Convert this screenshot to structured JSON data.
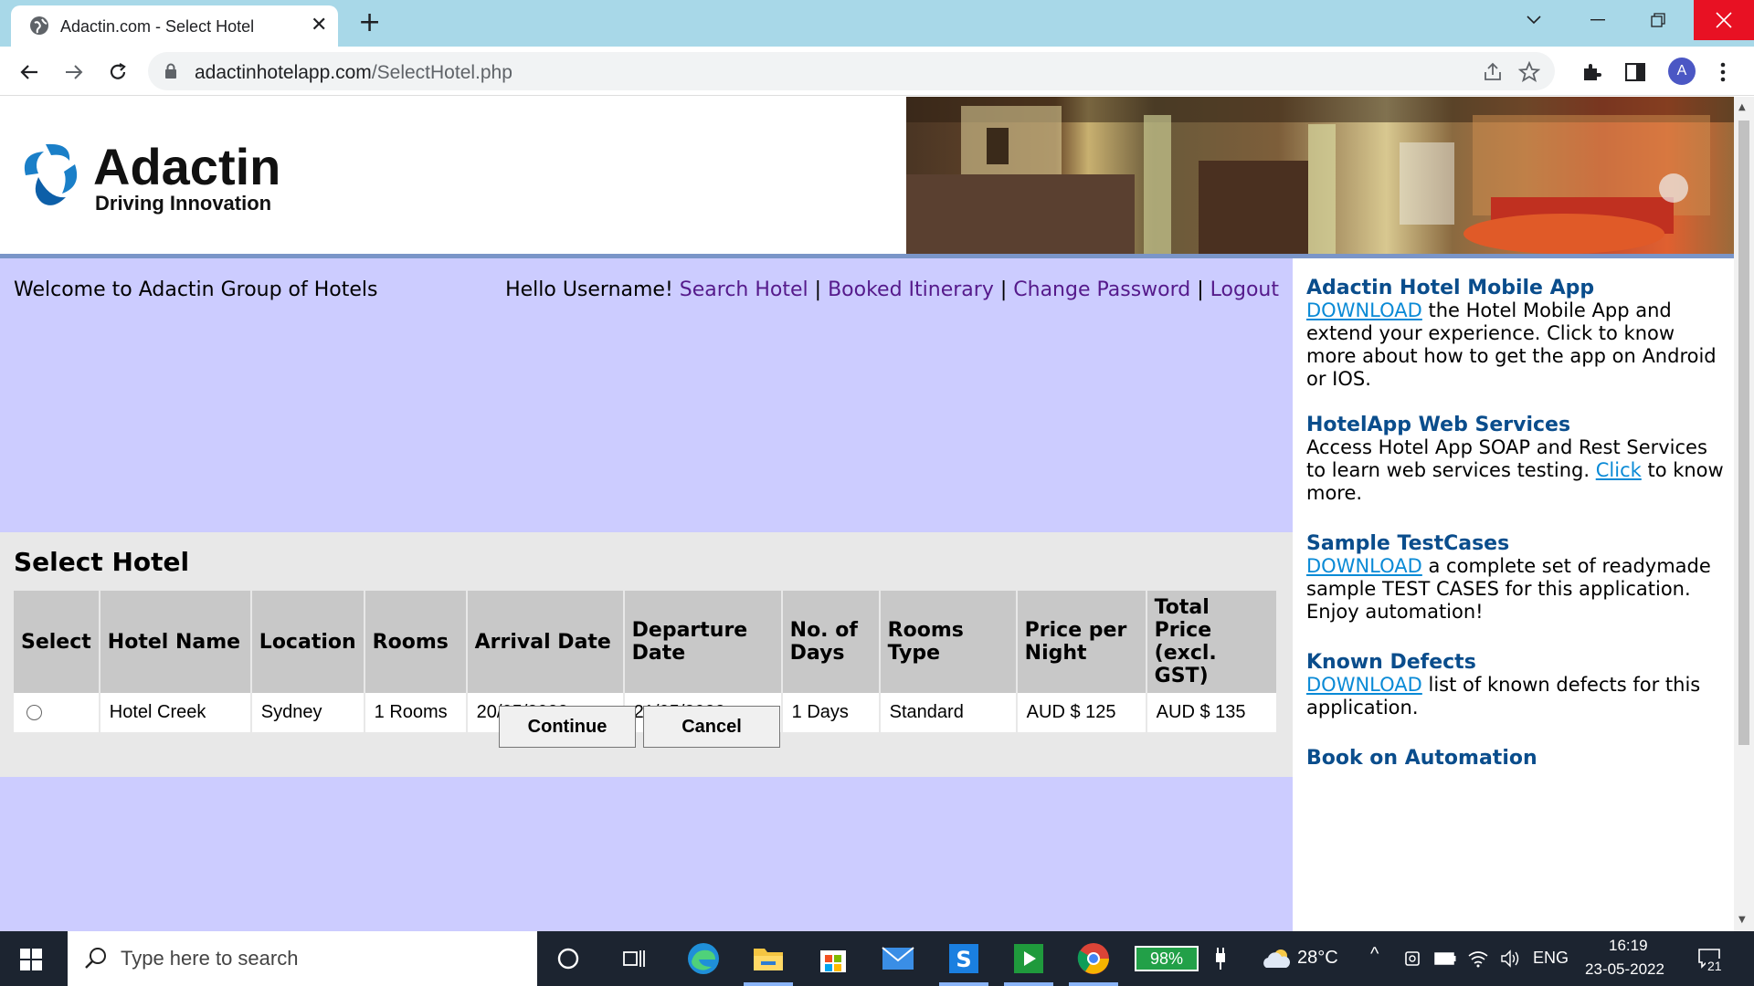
{
  "browser": {
    "tab_title": "Adactin.com - Select Hotel",
    "url_host": "adactinhotelapp.com",
    "url_path": "/SelectHotel.php",
    "profile_initial": "A"
  },
  "header": {
    "logo_name": "Adactin",
    "logo_tagline": "Driving Innovation"
  },
  "main": {
    "welcome": "Welcome to Adactin Group of Hotels",
    "greeting": "Hello Username!",
    "nav": {
      "search_hotel": "Search Hotel",
      "booked_itinerary": "Booked Itinerary",
      "change_password": "Change Password",
      "logout": "Logout",
      "separator": "|"
    },
    "heading": "Select Hotel",
    "table": {
      "headers": [
        "Select",
        "Hotel Name",
        "Location",
        "Rooms",
        "Arrival Date",
        "Departure Date",
        "No. of Days",
        "Rooms Type",
        "Price per Night",
        "Total Price (excl. GST)"
      ],
      "rows": [
        {
          "hotel_name": "Hotel Creek",
          "location": "Sydney",
          "rooms": "1 Rooms",
          "arrival": "20/05/2022",
          "departure": "21/05/2022",
          "days": "1 Days",
          "room_type": "Standard",
          "price_per_night": "AUD $ 125",
          "total_price": "AUD $ 135"
        }
      ]
    },
    "continue_label": "Continue",
    "cancel_label": "Cancel"
  },
  "sidebar": {
    "mobile_title": "Adactin Hotel Mobile App",
    "mobile_link": "DOWNLOAD",
    "mobile_text": " the Hotel Mobile App and extend your experience. Click to know more about how to get the app on Android or IOS.",
    "ws_title": "HotelApp Web Services",
    "ws_text_before": "Access Hotel App SOAP and Rest Services to learn web services testing. ",
    "ws_link": "Click",
    "ws_text_after": " to know more.",
    "tc_title": "Sample TestCases",
    "tc_link": "DOWNLOAD",
    "tc_text": " a complete set of readymade sample TEST CASES for this application. Enjoy automation!",
    "kd_title": "Known Defects",
    "kd_link": "DOWNLOAD",
    "kd_text": " list of known defects for this application.",
    "book_title": "Book on Automation"
  },
  "taskbar": {
    "search_placeholder": "Type here to search",
    "battery": "98%",
    "temperature": "28°C",
    "language": "ENG",
    "time": "16:19",
    "date": "23-05-2022",
    "notifications": "21"
  }
}
